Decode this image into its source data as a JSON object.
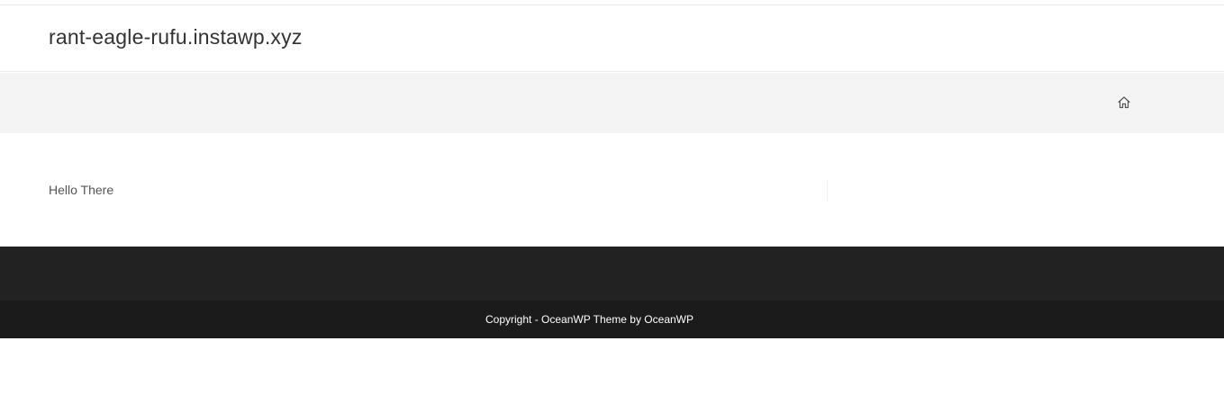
{
  "header": {
    "site_title": "rant-eagle-rufu.instawp.xyz"
  },
  "page_header": {
    "breadcrumb_home_icon": "home-icon"
  },
  "content": {
    "text": "Hello There"
  },
  "footer": {
    "copyright_prefix": "Copyright - ",
    "copyright_link": "OceanWP Theme by OceanWP"
  },
  "colors": {
    "footer_widgets_bg": "#222222",
    "footer_bottom_bg": "#1b1b1b",
    "page_header_bg": "#f4f4f4",
    "title_text": "#333333"
  }
}
